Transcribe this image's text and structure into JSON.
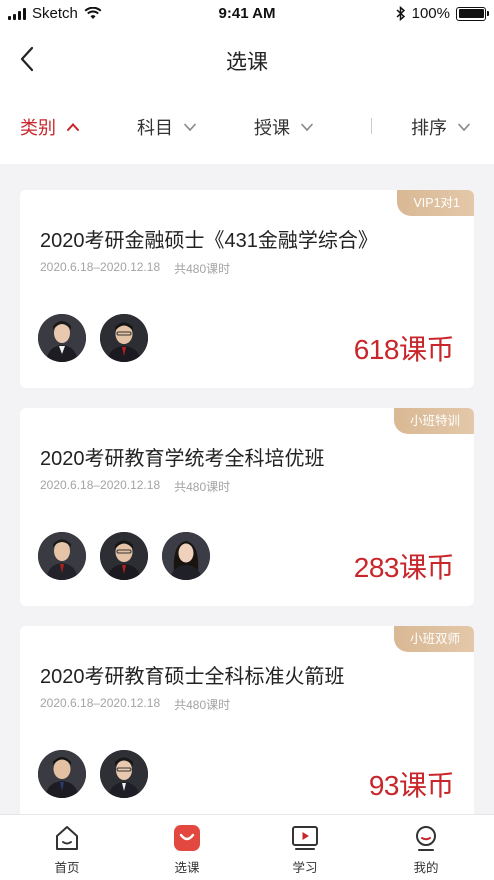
{
  "status_bar": {
    "carrier": "Sketch",
    "time": "9:41 AM",
    "battery": "100%"
  },
  "nav": {
    "title": "选课"
  },
  "filters": [
    {
      "label": "类别",
      "active": true
    },
    {
      "label": "科目",
      "active": false
    },
    {
      "label": "授课",
      "active": false
    },
    {
      "label": "排序",
      "active": false
    }
  ],
  "courses": [
    {
      "tag": "VIP1对1",
      "title": "2020考研金融硕士《431金融学综合》",
      "dates": "2020.6.18–2020.12.18",
      "hours": "共480课时",
      "teacher_count": 2,
      "price": "618课币"
    },
    {
      "tag": "小班特训",
      "title": "2020考研教育学统考全科培优班",
      "dates": "2020.6.18–2020.12.18",
      "hours": "共480课时",
      "teacher_count": 3,
      "price": "283课币"
    },
    {
      "tag": "小班双师",
      "title": "2020考研教育硕士全科标准火箭班",
      "dates": "2020.6.18–2020.12.18",
      "hours": "共480课时",
      "teacher_count": 2,
      "price": "93课币"
    }
  ],
  "tabs": [
    {
      "label": "首页",
      "icon": "home-icon"
    },
    {
      "label": "选课",
      "icon": "course-icon",
      "active": true
    },
    {
      "label": "学习",
      "icon": "video-icon"
    },
    {
      "label": "我的",
      "icon": "profile-icon"
    }
  ],
  "colors": {
    "accent": "#c8262b",
    "tag_gold": "#d9b894",
    "background": "#f3f3f5"
  }
}
